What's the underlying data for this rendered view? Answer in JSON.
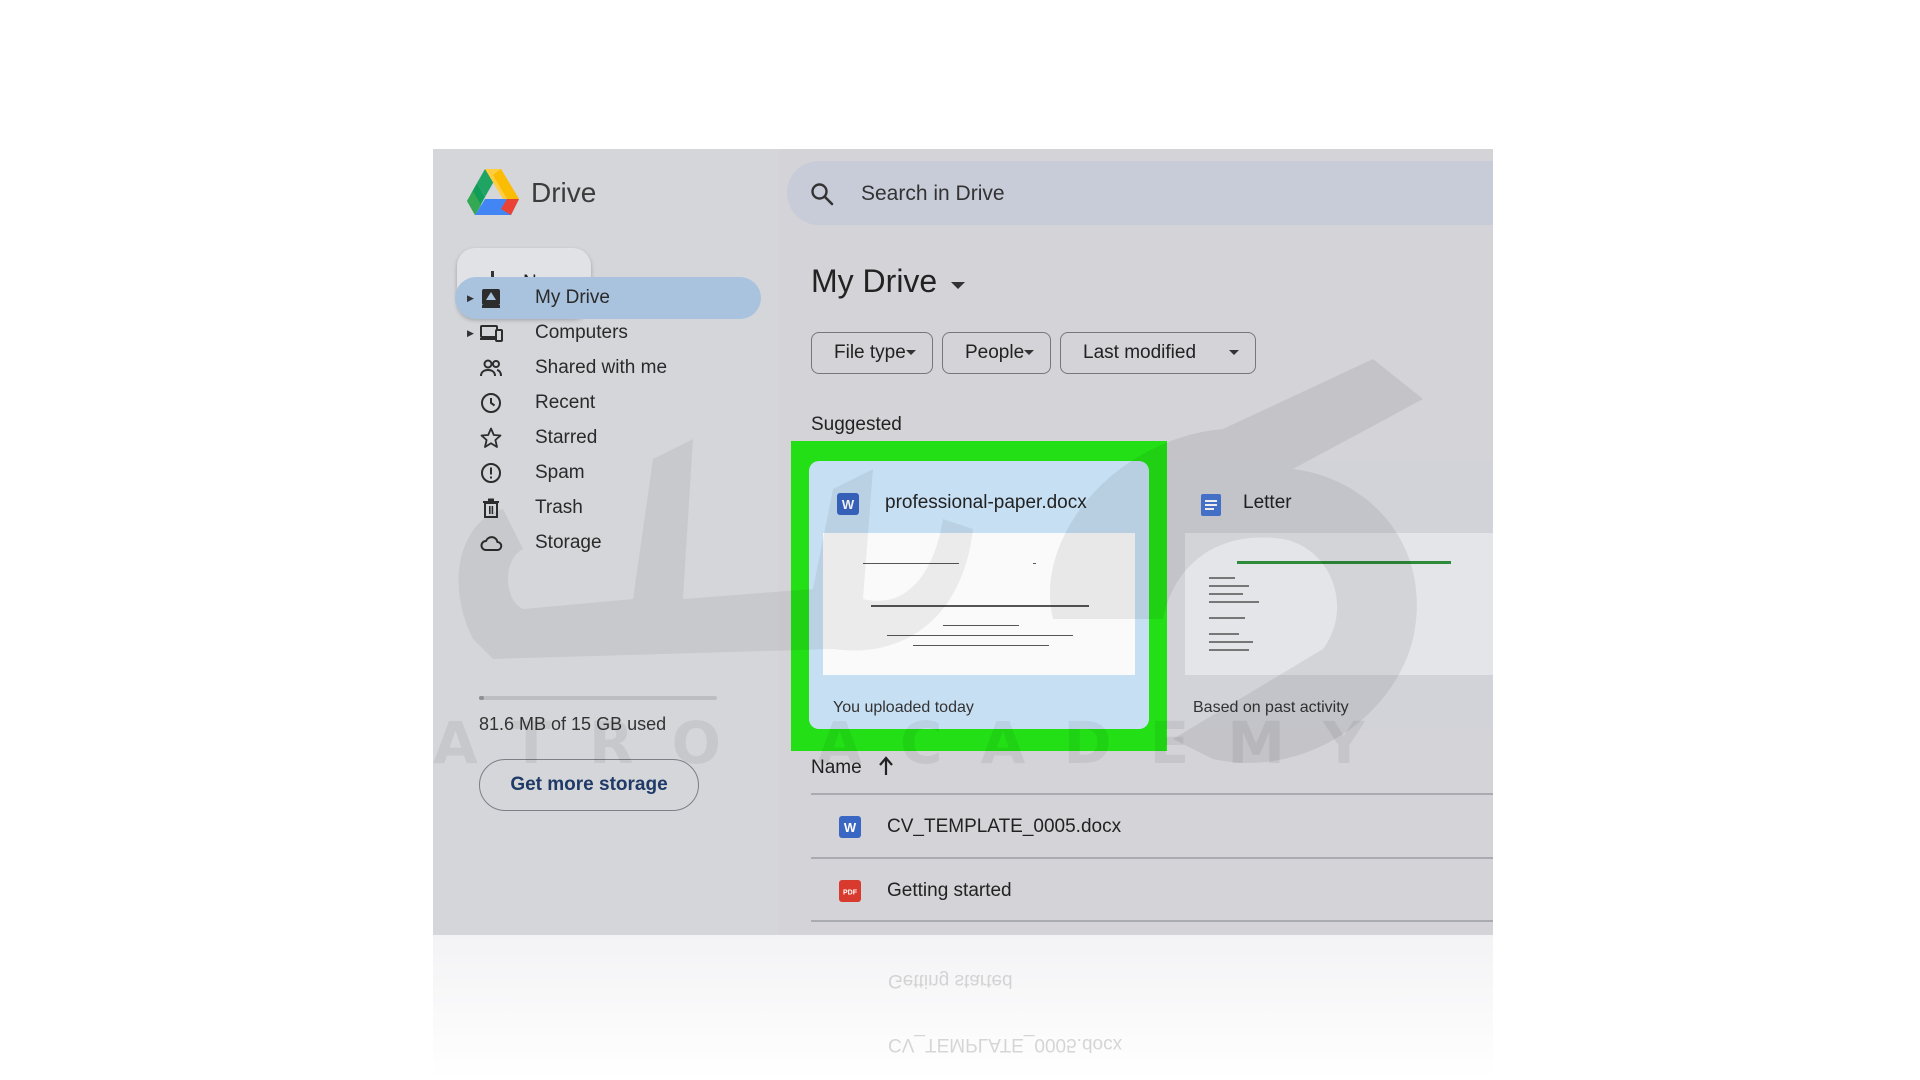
{
  "app": {
    "title": "Drive"
  },
  "sidebar": {
    "new_label": "New",
    "items": [
      {
        "label": "My Drive",
        "icon": "my-drive-icon",
        "active": true,
        "expandable": true
      },
      {
        "label": "Computers",
        "icon": "computers-icon",
        "active": false,
        "expandable": true
      },
      {
        "label": "Shared with me",
        "icon": "shared-icon",
        "active": false,
        "expandable": false
      },
      {
        "label": "Recent",
        "icon": "clock-icon",
        "active": false,
        "expandable": false
      },
      {
        "label": "Starred",
        "icon": "star-icon",
        "active": false,
        "expandable": false
      },
      {
        "label": "Spam",
        "icon": "spam-icon",
        "active": false,
        "expandable": false
      },
      {
        "label": "Trash",
        "icon": "trash-icon",
        "active": false,
        "expandable": false
      },
      {
        "label": "Storage",
        "icon": "cloud-icon",
        "active": false,
        "expandable": false
      }
    ],
    "storage_used_fraction": 0.005,
    "storage_text": "81.6 MB of 15 GB used",
    "get_storage_label": "Get more storage"
  },
  "search": {
    "placeholder": "Search in Drive"
  },
  "main": {
    "title": "My Drive",
    "filters": [
      "File type",
      "People",
      "Last modified"
    ],
    "suggested_label": "Suggested",
    "suggested": [
      {
        "name": "professional-paper.docx",
        "type": "word",
        "subtitle": "You uploaded today",
        "highlighted": true
      },
      {
        "name": "Letter",
        "type": "docs",
        "subtitle": "Based on past activity",
        "highlighted": false
      }
    ],
    "list_header": "Name",
    "files": [
      {
        "name": "CV_TEMPLATE_0005.docx",
        "type": "word"
      },
      {
        "name": "Getting started",
        "type": "pdf"
      }
    ]
  },
  "watermark": {
    "text": "ATRO ACADEMY"
  },
  "colors": {
    "highlight": "#22e015",
    "active_nav": "#a9c3de",
    "word_blue": "#3a66c4",
    "pdf_red": "#d93a2e"
  }
}
